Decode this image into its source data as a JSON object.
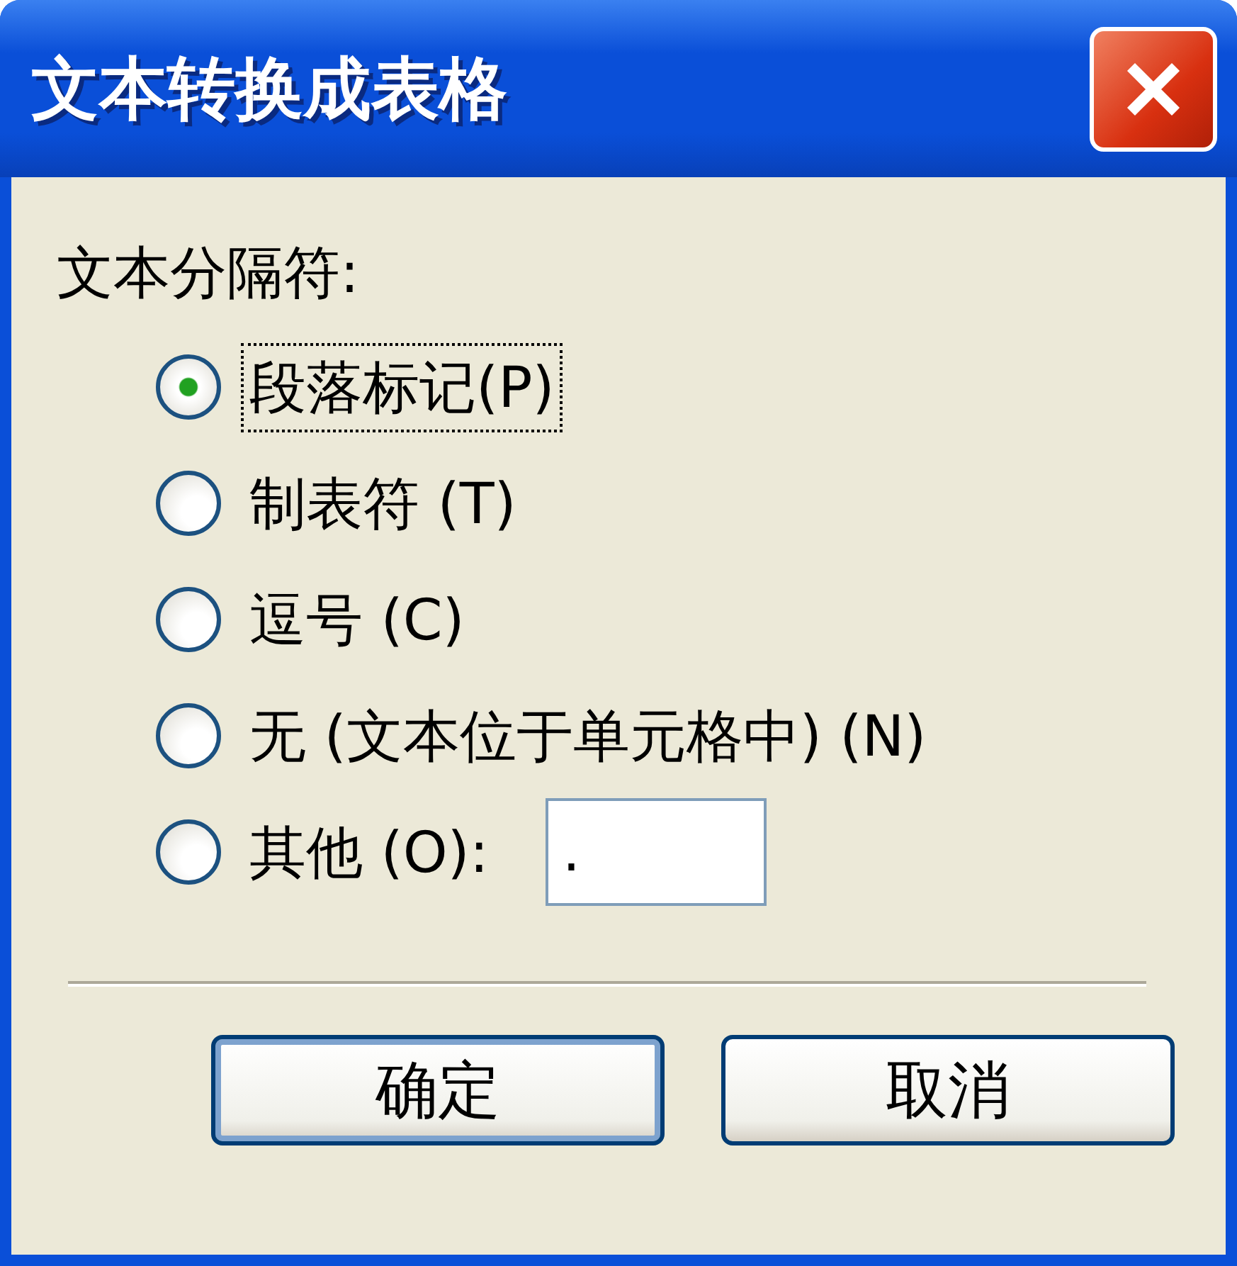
{
  "window": {
    "title": "文本转换成表格"
  },
  "separator_group": {
    "label": "文本分隔符:",
    "options": [
      {
        "label": "段落标记(P)",
        "selected": true,
        "kind": "radio"
      },
      {
        "label": "制表符 (T)",
        "selected": false,
        "kind": "radio"
      },
      {
        "label": "逗号 (C)",
        "selected": false,
        "kind": "radio"
      },
      {
        "label": "无 (文本位于单元格中) (N)",
        "selected": false,
        "kind": "radio"
      },
      {
        "label": "其他 (O):",
        "selected": false,
        "kind": "radio_field"
      }
    ],
    "other_field": {
      "value": "."
    }
  },
  "buttons": [
    {
      "label": "确定",
      "default": true
    },
    {
      "label": "取消",
      "default": false
    }
  ]
}
